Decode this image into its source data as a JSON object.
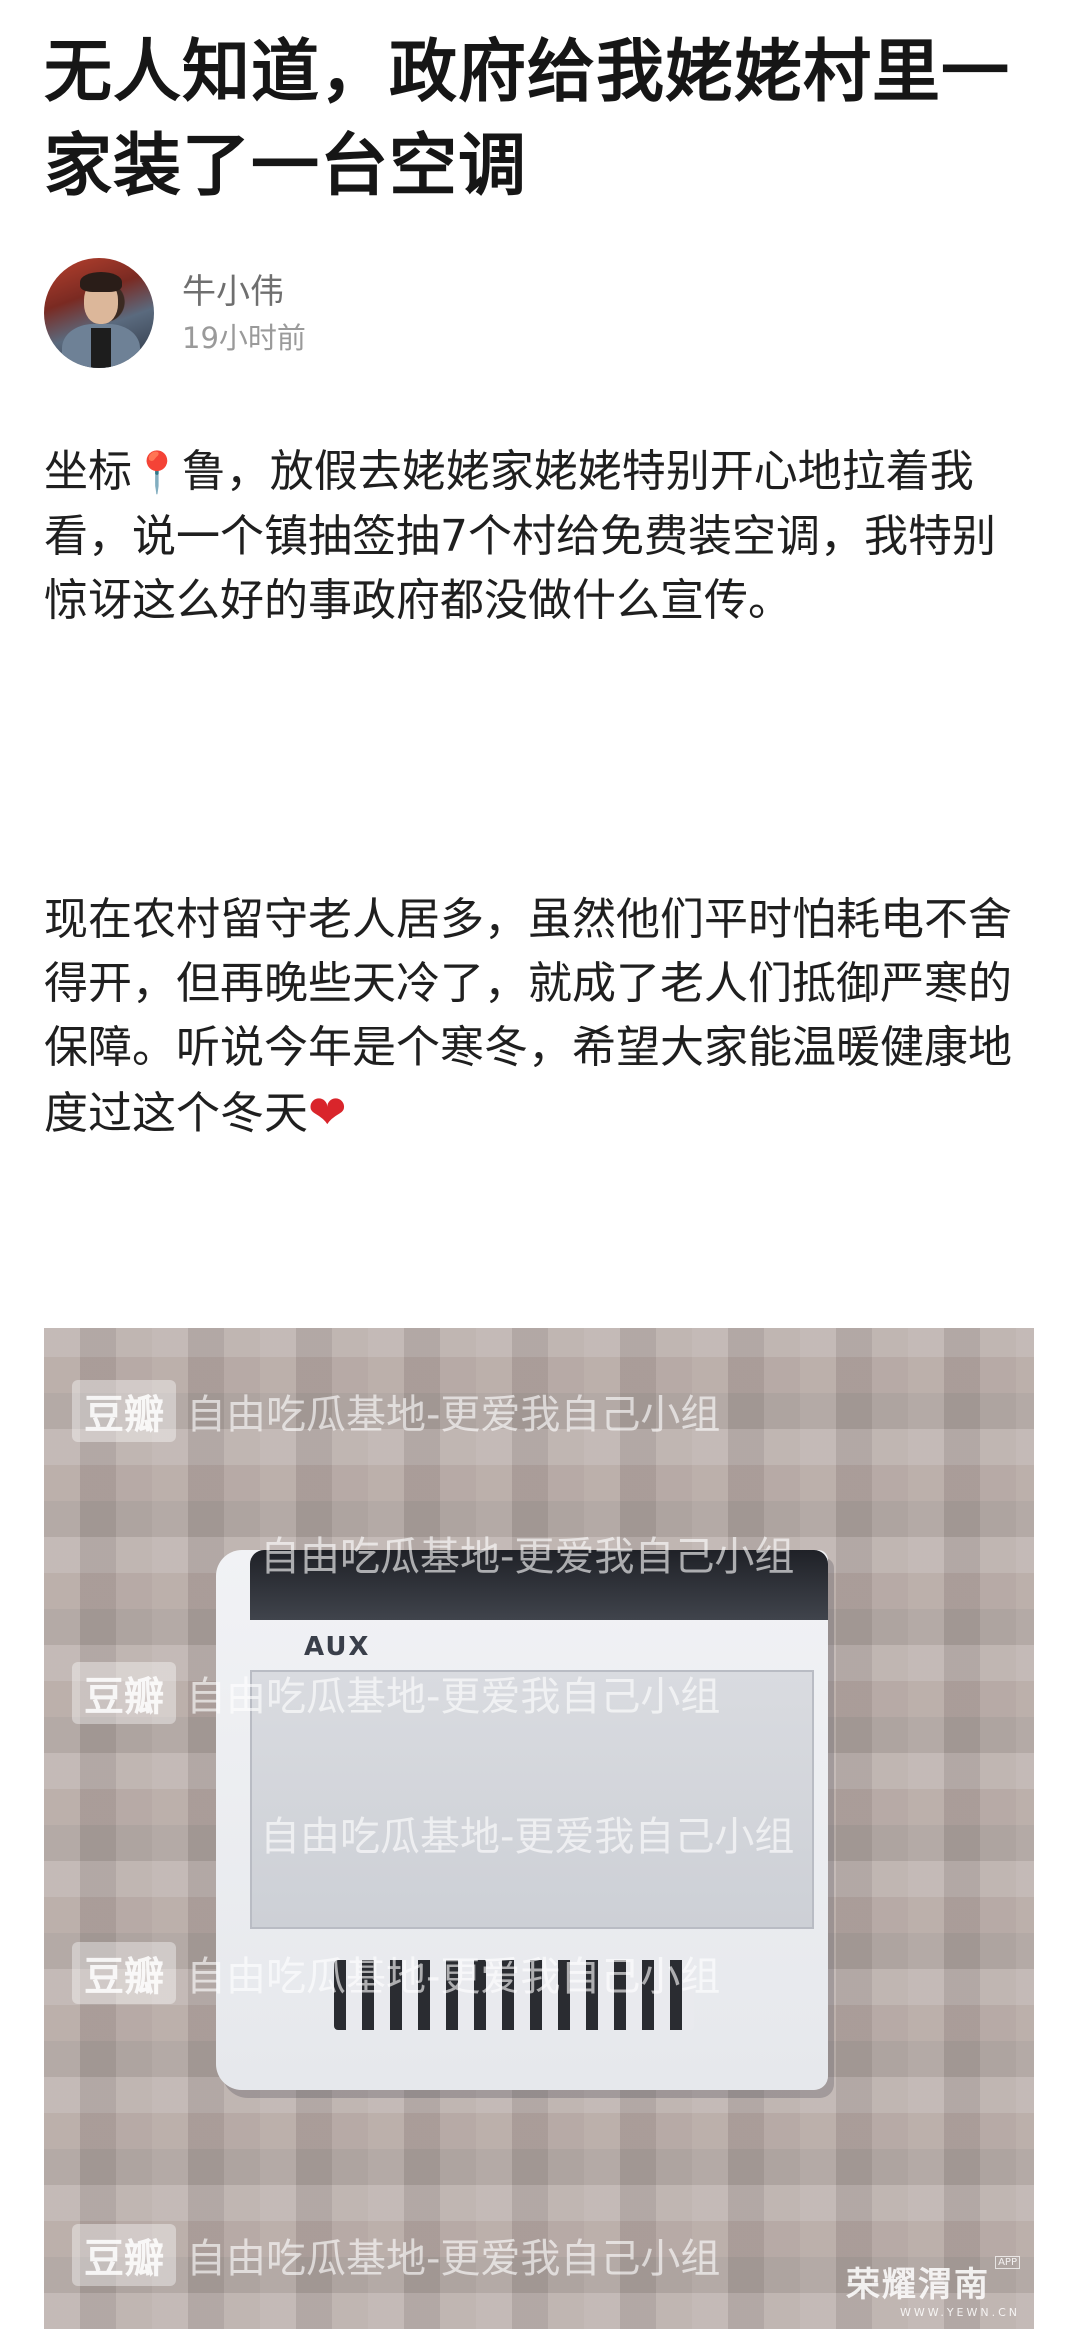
{
  "post": {
    "title": "无人知道，政府给我姥姥村里一家装了一台空调",
    "author_name": "牛小伟",
    "timestamp": "19小时前",
    "para1_a": "坐标",
    "para1_pin": "📍",
    "para1_b": "鲁，放假去姥姥家姥姥特别开心地拉着我看，说一个镇抽签抽7个村给免费装空调，我特别惊讶这么好的事政府都没做什么宣传。",
    "para2": "现在农村留守老人居多，虽然他们平时怕耗电不舍得开，但再晚些天冷了，就成了老人们抵御严寒的保障。听说今年是个寒冬，希望大家能温暖健康地度过这个冬天",
    "para2_heart": "❤"
  },
  "photo": {
    "watermark_logo": "豆瓣",
    "watermark_text": "自由吃瓜基地-更爱我自己小组",
    "ac_brand": "AUX",
    "brand_name": "荣耀渭南",
    "brand_url": "WWW.YEWN.CN",
    "brand_badge": "APP"
  },
  "colors": {
    "title": "#161616",
    "author": "#6f6f6f",
    "timestamp": "#9a9a9a",
    "heart": "#d9252b"
  }
}
